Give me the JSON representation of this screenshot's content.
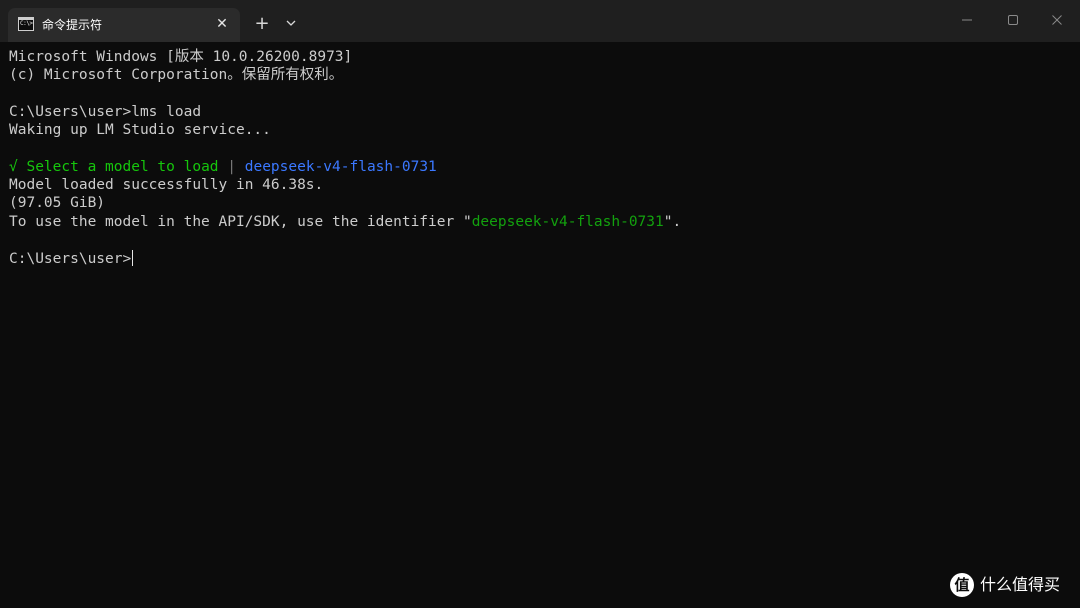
{
  "window": {
    "tab_title": "命令提示符",
    "tab_icon_prompt": "C:\\>",
    "close_tab_glyph": "✕",
    "new_tab_glyph": "+",
    "icons": {
      "tab": "terminal-icon",
      "close_tab": "close-icon",
      "new_tab": "plus-icon",
      "dropdown": "chevron-down-icon",
      "minimize": "minimize-icon",
      "maximize": "maximize-icon",
      "close_window": "close-icon"
    }
  },
  "terminal": {
    "line1": "Microsoft Windows [版本 10.0.26200.8973]",
    "line2": "(c) Microsoft Corporation。保留所有权利。",
    "prompt1": "C:\\Users\\user>",
    "command1": "lms load",
    "waking": "Waking up LM Studio service...",
    "check": "√",
    "select_label": "Select a model to load",
    "separator": "|",
    "selected_model": "deepseek-v4-flash-0731",
    "loaded": "Model loaded successfully in 46.38s.",
    "size": "(97.05 GiB)",
    "identifier_prefix": "To use the model in the API/SDK, use the identifier \"",
    "identifier": "deepseek-v4-flash-0731",
    "identifier_suffix": "\".",
    "prompt2": "C:\\Users\\user>"
  },
  "watermark": {
    "badge": "值",
    "text": "什么值得买"
  },
  "colors": {
    "background": "#0c0c0c",
    "titlebar": "#1f1f1f",
    "tab": "#2b2b2b",
    "text": "#cccccc",
    "success_green": "#16c60c",
    "model_blue": "#3b78ff",
    "identifier_green": "#13a10e"
  }
}
